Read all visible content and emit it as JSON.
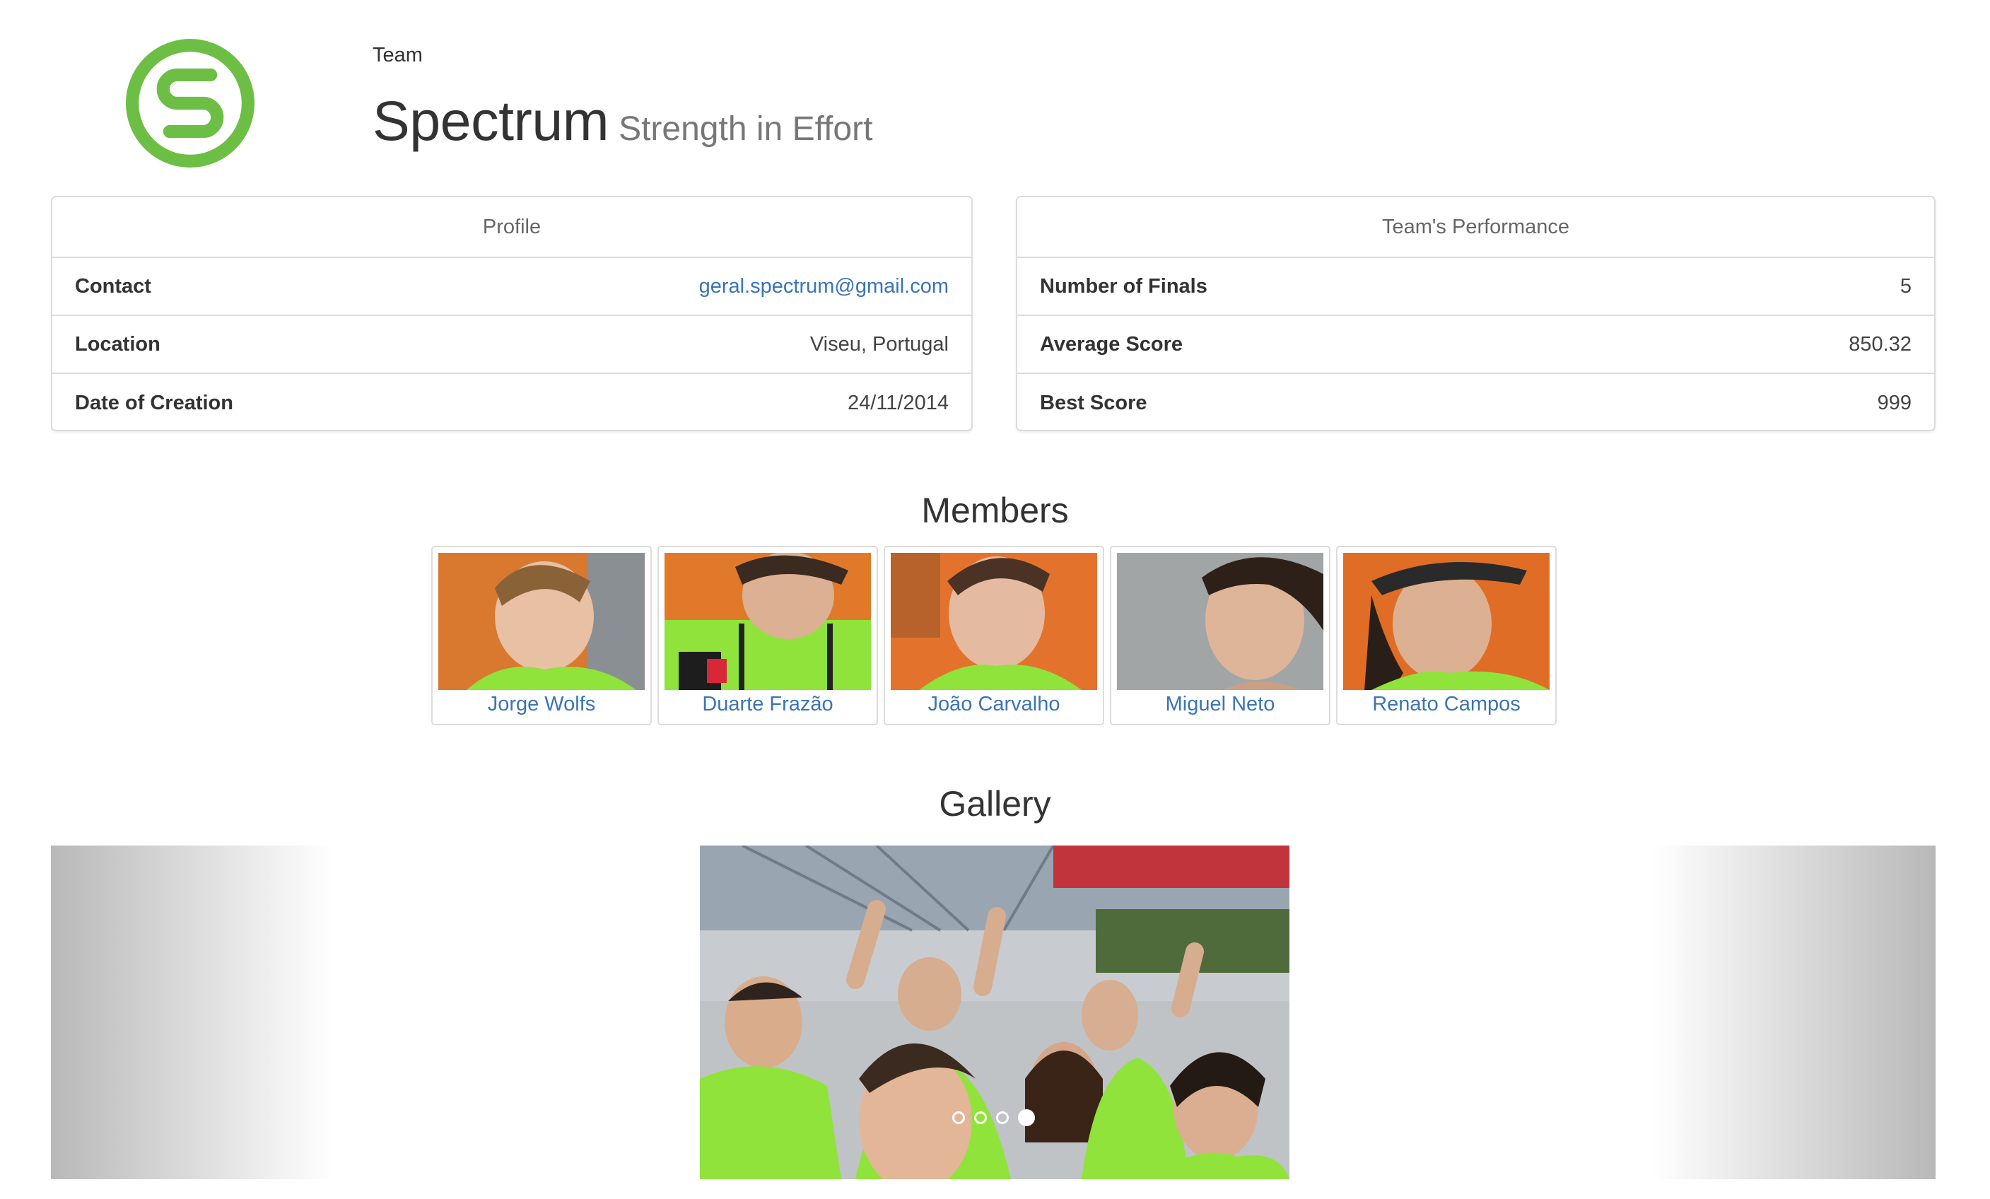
{
  "header": {
    "eyebrow": "Team",
    "team_name": "Spectrum",
    "motto": "Strength in Effort",
    "logo_icon": "spectrum-s-logo",
    "logo_color": "#6cbf44"
  },
  "profile": {
    "title": "Profile",
    "rows": [
      {
        "label": "Contact",
        "value": "geral.spectrum@gmail.com"
      },
      {
        "label": "Location",
        "value": "Viseu, Portugal"
      },
      {
        "label": "Date of Creation",
        "value": "24/11/2014"
      }
    ]
  },
  "performance": {
    "title": "Team's Performance",
    "rows": [
      {
        "label": "Number of Finals",
        "value": "5"
      },
      {
        "label": "Average Score",
        "value": "850.32"
      },
      {
        "label": "Best Score",
        "value": "999"
      }
    ]
  },
  "members": {
    "title": "Members",
    "items": [
      {
        "name": "Jorge Wolfs"
      },
      {
        "name": "Duarte Frazão"
      },
      {
        "name": "João Carvalho"
      },
      {
        "name": "Miguel Neto"
      },
      {
        "name": "Renato Campos"
      }
    ]
  },
  "gallery": {
    "title": "Gallery",
    "slide_count": 4,
    "active_slide": 4
  },
  "colors": {
    "link": "#3a74b5",
    "shirt_green": "#8fe33a",
    "border": "#dcdcdc"
  }
}
